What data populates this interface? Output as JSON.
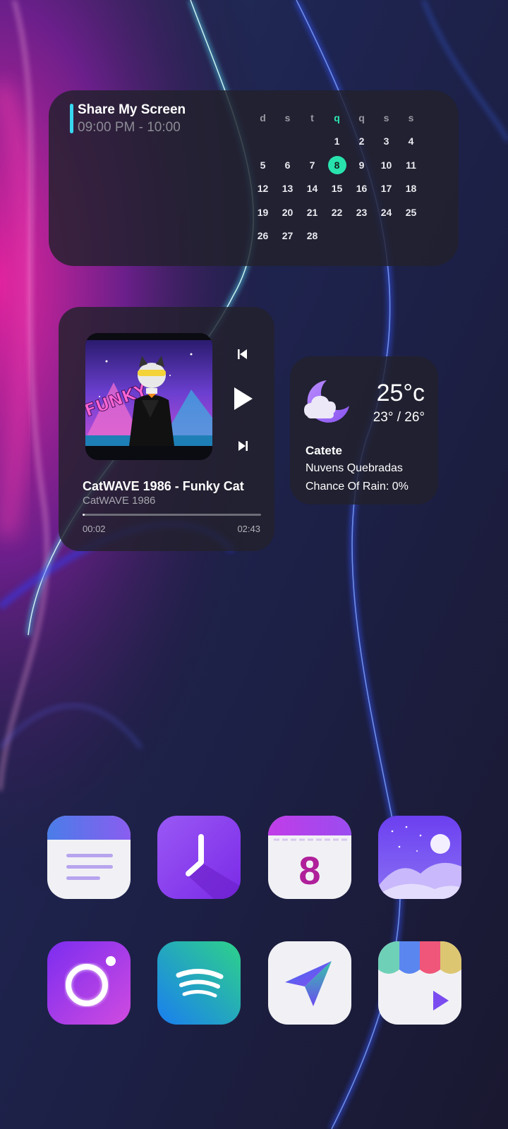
{
  "calendar": {
    "event_title": "Share My Screen",
    "event_time": "09:00 PM - 10:00",
    "weekdays": [
      "d",
      "s",
      "t",
      "q",
      "q",
      "s",
      "s"
    ],
    "today_column": 3,
    "today": "8",
    "weeks": [
      [
        "",
        "",
        "",
        "1",
        "2",
        "3",
        "4"
      ],
      [
        "5",
        "6",
        "7",
        "8",
        "9",
        "10",
        "11"
      ],
      [
        "12",
        "13",
        "14",
        "15",
        "16",
        "17",
        "18"
      ],
      [
        "19",
        "20",
        "21",
        "22",
        "23",
        "24",
        "25"
      ],
      [
        "26",
        "27",
        "28",
        "",
        "",
        "",
        ""
      ]
    ],
    "accent": "#39d7f0",
    "today_color": "#28e3ad"
  },
  "music": {
    "title": "CatWAVE 1986 - Funky Cat",
    "artist": "CatWAVE 1986",
    "elapsed": "00:02",
    "total": "02:43",
    "progress_fraction": 0.012,
    "album_art_text": "FUNKY",
    "controls": [
      "skip-previous-icon",
      "play-icon",
      "skip-next-icon"
    ]
  },
  "weather": {
    "temperature": "25°c",
    "range": "23° / 26°",
    "location": "Catete",
    "condition": "Nuvens Quebradas",
    "rain": "Chance Of Rain: 0%",
    "icon": "moon-cloud-icon"
  },
  "apps": [
    {
      "id": "notes-app",
      "icon": "notes-icon"
    },
    {
      "id": "clock-app",
      "icon": "clock-icon"
    },
    {
      "id": "calendar-app",
      "icon": "calendar-icon",
      "label": "8"
    },
    {
      "id": "gallery-app",
      "icon": "gallery-icon"
    },
    {
      "id": "camera-app",
      "icon": "camera-icon"
    },
    {
      "id": "spotify-app",
      "icon": "spotify-icon"
    },
    {
      "id": "browser-app",
      "icon": "paper-plane-icon"
    },
    {
      "id": "store-app",
      "icon": "store-icon"
    }
  ]
}
